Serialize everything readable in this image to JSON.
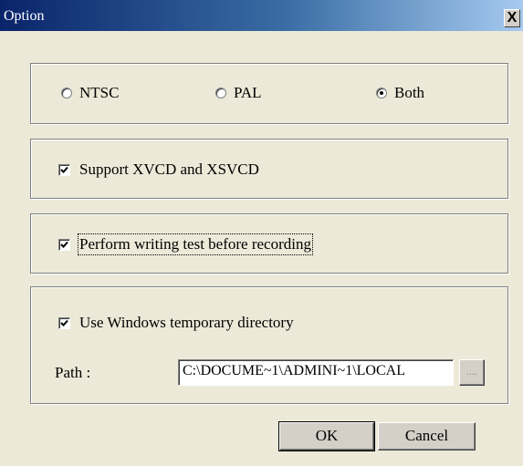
{
  "window": {
    "title": "Option",
    "close_label": "X"
  },
  "video_format": {
    "options": [
      {
        "label": "NTSC",
        "selected": false
      },
      {
        "label": "PAL",
        "selected": false
      },
      {
        "label": "Both",
        "selected": true
      }
    ]
  },
  "support_xvcd": {
    "label": "Support XVCD and XSVCD",
    "checked": true
  },
  "writing_test": {
    "label": "Perform writing test before recording",
    "checked": true
  },
  "temp_dir": {
    "label": "Use Windows temporary directory",
    "checked": true,
    "path_label": "Path :",
    "path_value": "C:\\DOCUME~1\\ADMINI~1\\LOCAL",
    "browse_label": "...."
  },
  "buttons": {
    "ok_label": "OK",
    "cancel_label": "Cancel"
  }
}
